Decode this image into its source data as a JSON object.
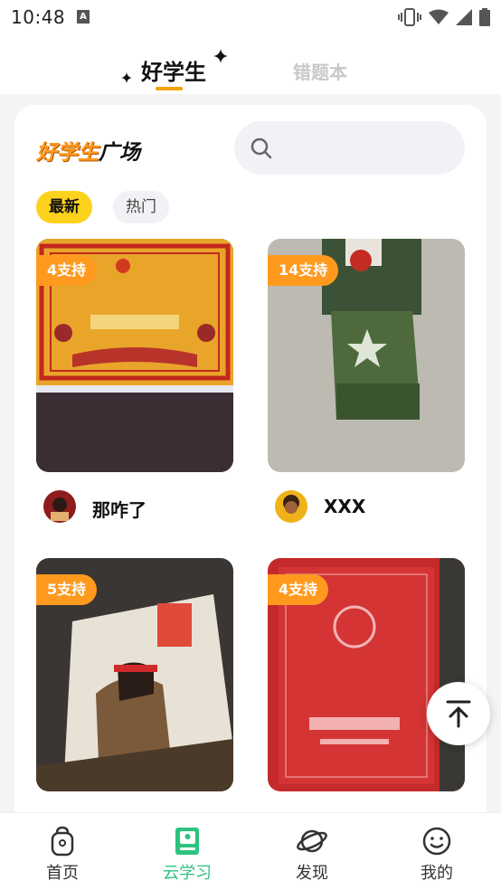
{
  "status_bar": {
    "time": "10:48",
    "notification_glyph": "A"
  },
  "top_tabs": {
    "active": "好学生",
    "inactive": "错题本"
  },
  "brand": {
    "part1": "好学生",
    "part2": "广场"
  },
  "filters": {
    "latest": "最新",
    "hot": "热门"
  },
  "posts": [
    {
      "badge": "4支持",
      "author": "那咋了"
    },
    {
      "badge": "14支持",
      "author": "XXX"
    },
    {
      "badge": "5支持",
      "author": ""
    },
    {
      "badge": "4支持",
      "author": ""
    }
  ],
  "nav": {
    "home": "首页",
    "cloud_study": "云学习",
    "discover": "发现",
    "mine": "我的",
    "active_color": "#2ec27e"
  },
  "colors": {
    "accent_orange": "#ff9a1f",
    "filter_yellow": "#fcd21c"
  }
}
